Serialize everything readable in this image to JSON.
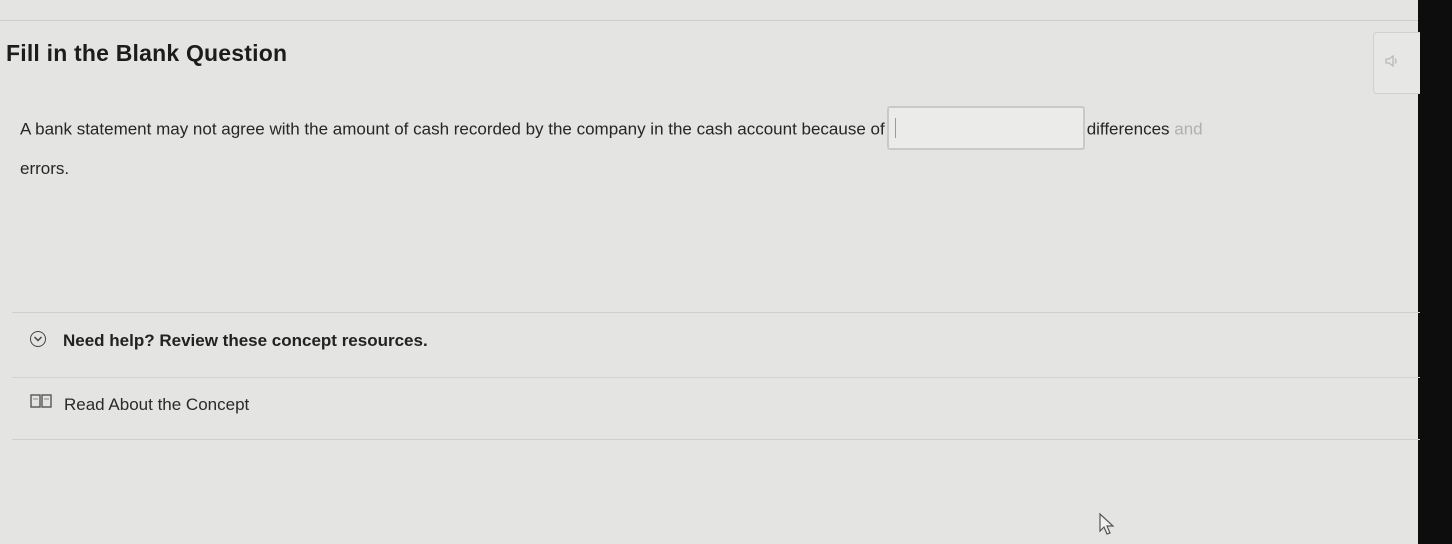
{
  "question": {
    "title": "Fill in the Blank Question",
    "text_before": "A bank statement may not agree with the amount of cash recorded by the company in the cash account because of",
    "blank_value": "",
    "text_after_visible": "differences",
    "text_after_faded": " and",
    "text_line2": "errors."
  },
  "audio": {
    "icon": "speaker-icon"
  },
  "help": {
    "label": "Need help? Review these concept resources.",
    "icon": "chevron-down-circle-icon",
    "resources": [
      {
        "label": "Read About the Concept",
        "icon": "book-icon"
      }
    ]
  }
}
